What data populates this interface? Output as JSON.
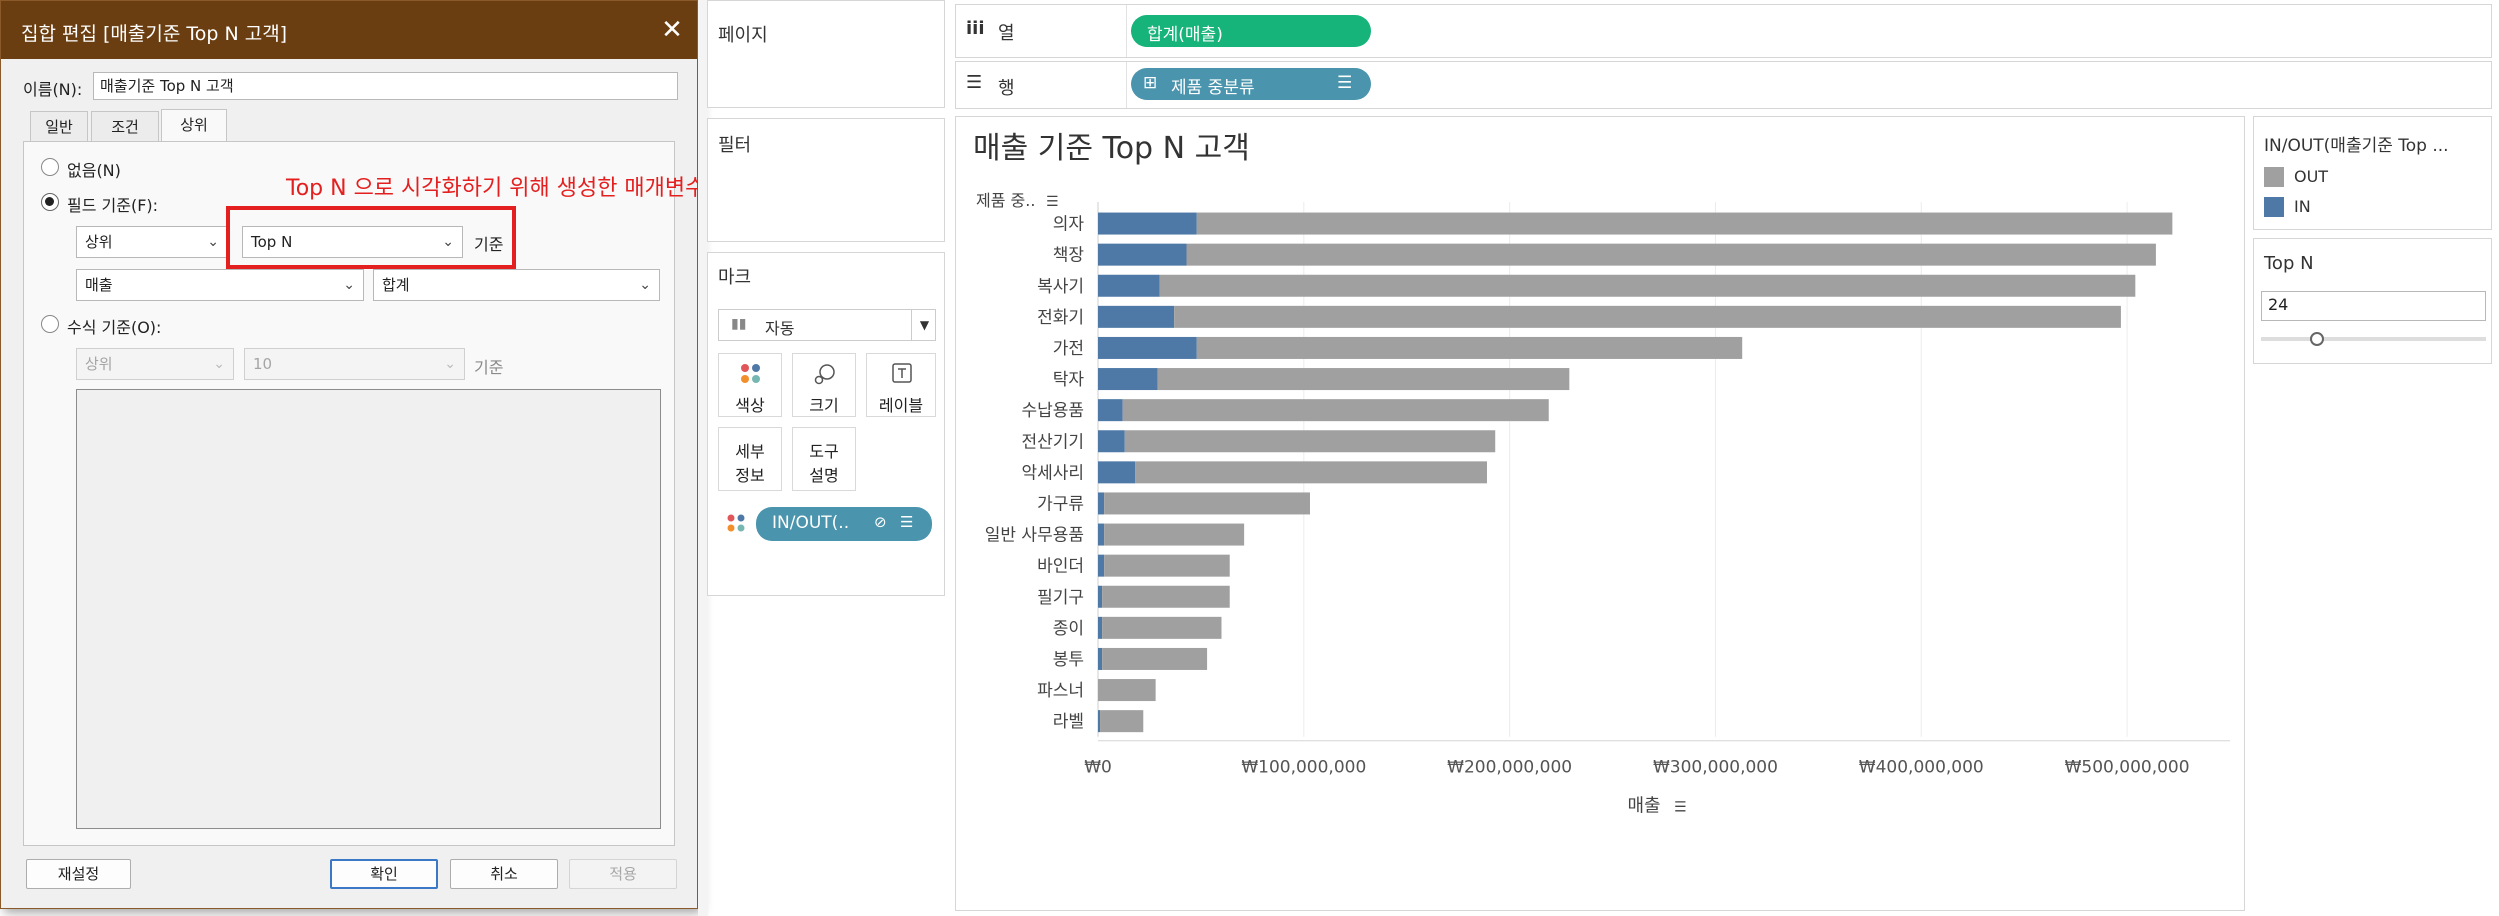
{
  "dialog": {
    "title": "집합 편집 [매출기준 Top N 고객]",
    "name_label": "이름(N):",
    "name_value": "매출기준 Top N 고객",
    "tabs": [
      "일반",
      "조건",
      "상위"
    ],
    "radio_none": "없음(N)",
    "radio_field": "필드 기준(F):",
    "field_direction": "상위",
    "field_param": "Top N",
    "field_by_label": "기준",
    "field_measure": "매출",
    "field_agg": "합계",
    "radio_formula": "수식 기준(O):",
    "formula_direction": "상위",
    "formula_value": "10",
    "formula_by_label": "기준",
    "btn_reset": "재설정",
    "btn_ok": "확인",
    "btn_cancel": "취소",
    "btn_apply": "적용"
  },
  "annotation": "Top N 으로 시각화하기 위해 생성한 매개변수",
  "panes": {
    "pages": "페이지",
    "filters": "필터",
    "marks": "마크",
    "mark_type": "자동",
    "mark_buttons": {
      "color": "색상",
      "size": "크기",
      "label": "레이블",
      "detail_1": "세부",
      "detail_2": "정보",
      "tooltip_1": "도구",
      "tooltip_2": "설명"
    },
    "mark_pill": "IN/OUT(.."
  },
  "shelves": {
    "columns_label": "열",
    "columns_pill": "합계(매출)",
    "rows_label": "행",
    "rows_pill": "제품 중분류"
  },
  "legend": {
    "title": "IN/OUT(매출기준 Top ...",
    "items": [
      {
        "label": "OUT",
        "color": "#a0a0a0"
      },
      {
        "label": "IN",
        "color": "#4e79a7"
      }
    ]
  },
  "parameter": {
    "title": "Top N",
    "value": "24",
    "slider_position": 0.25
  },
  "colors": {
    "in": "#4e79a7",
    "out": "#a0a0a0",
    "dialog_title": "#6b3e11",
    "pill_green": "#16b37a",
    "pill_blue": "#4a94ad",
    "annotation": "#e41f1f"
  },
  "chart_data": {
    "type": "bar",
    "orientation": "horizontal",
    "stacked": true,
    "title": "매출 기준 Top N 고객",
    "row_header": "제품 중..",
    "xlabel": "매출",
    "xlim": [
      0,
      550000000
    ],
    "xticks": [
      0,
      100000000,
      200000000,
      300000000,
      400000000,
      500000000
    ],
    "xtick_labels": [
      "₩0",
      "₩100,000,000",
      "₩200,000,000",
      "₩300,000,000",
      "₩400,000,000",
      "₩500,000,000"
    ],
    "grid": true,
    "categories": [
      "의자",
      "책장",
      "복사기",
      "전화기",
      "가전",
      "탁자",
      "수납용품",
      "전산기기",
      "악세사리",
      "가구류",
      "일반 사무용품",
      "바인더",
      "필기구",
      "종이",
      "봉투",
      "파스너",
      "라벨"
    ],
    "series": [
      {
        "name": "IN",
        "values": [
          48000000,
          43000000,
          30000000,
          37000000,
          48000000,
          29000000,
          12000000,
          13000000,
          18000000,
          3000000,
          3000000,
          3000000,
          2000000,
          2000000,
          2000000,
          0,
          1000000
        ]
      },
      {
        "name": "OUT",
        "values": [
          474000000,
          471000000,
          474000000,
          460000000,
          265000000,
          200000000,
          207000000,
          180000000,
          171000000,
          100000000,
          68000000,
          61000000,
          62000000,
          58000000,
          51000000,
          28000000,
          21000000
        ]
      }
    ]
  }
}
